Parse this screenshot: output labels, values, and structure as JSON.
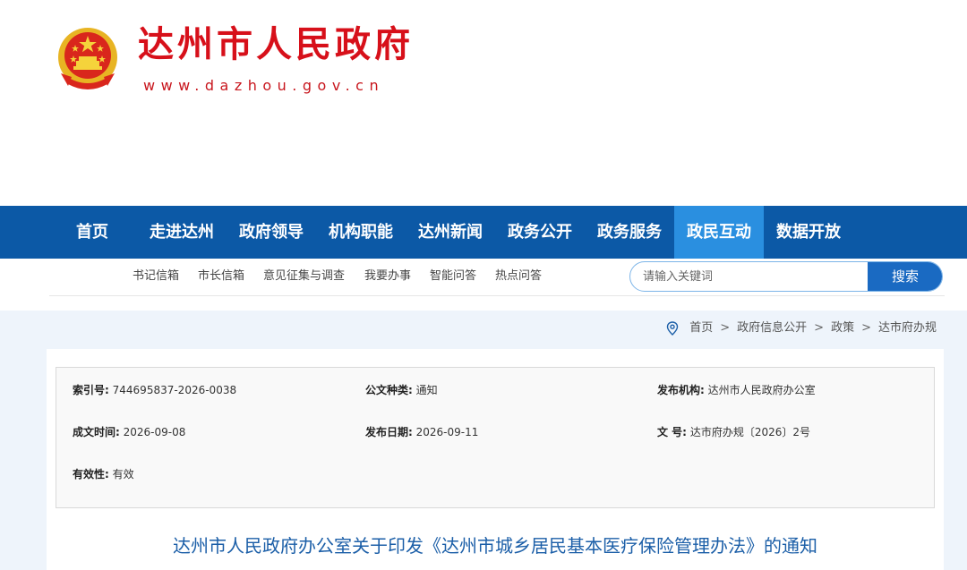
{
  "header": {
    "title": "达州市人民政府",
    "url": "www.dazhou.gov.cn",
    "emblem_icon": "national-emblem-icon"
  },
  "main_nav": {
    "items": [
      {
        "label": "首页"
      },
      {
        "label": "走进达州"
      },
      {
        "label": "政府领导"
      },
      {
        "label": "机构职能"
      },
      {
        "label": "达州新闻"
      },
      {
        "label": "政务公开"
      },
      {
        "label": "政务服务"
      },
      {
        "label": "政民互动",
        "active": true
      },
      {
        "label": "数据开放"
      }
    ]
  },
  "sub_nav": {
    "items": [
      {
        "label": "书记信箱"
      },
      {
        "label": "市长信箱"
      },
      {
        "label": "意见征集与调查"
      },
      {
        "label": "我要办事"
      },
      {
        "label": "智能问答"
      },
      {
        "label": "热点问答"
      }
    ]
  },
  "search": {
    "placeholder": "请输入关键词",
    "button_label": "搜索"
  },
  "breadcrumb": {
    "icon": "location-pin-icon",
    "items": [
      "首页",
      "政府信息公开",
      "政策",
      "达市府办规"
    ],
    "separator": ">"
  },
  "meta": {
    "index_label": "索引号:",
    "index_value": "744695837-2026-0038",
    "doctype_label": "公文种类:",
    "doctype_value": "通知",
    "issuer_label": "发布机构:",
    "issuer_value": "达州市人民政府办公室",
    "created_label": "成文时间:",
    "created_value": "2026-09-08",
    "published_label": "发布日期:",
    "published_value": "2026-09-11",
    "docno_label": "文 号:",
    "docno_value": "达市府办规〔2026〕2号",
    "validity_label": "有效性:",
    "validity_value": "有效"
  },
  "document": {
    "title": "达州市人民政府办公室关于印发《达州市城乡居民基本医疗保险管理办法》的通知"
  },
  "colors": {
    "brand_red": "#d7101a",
    "nav_blue": "#0c59a6",
    "nav_active": "#2a8fe0",
    "title_blue": "#1c5fa8"
  }
}
